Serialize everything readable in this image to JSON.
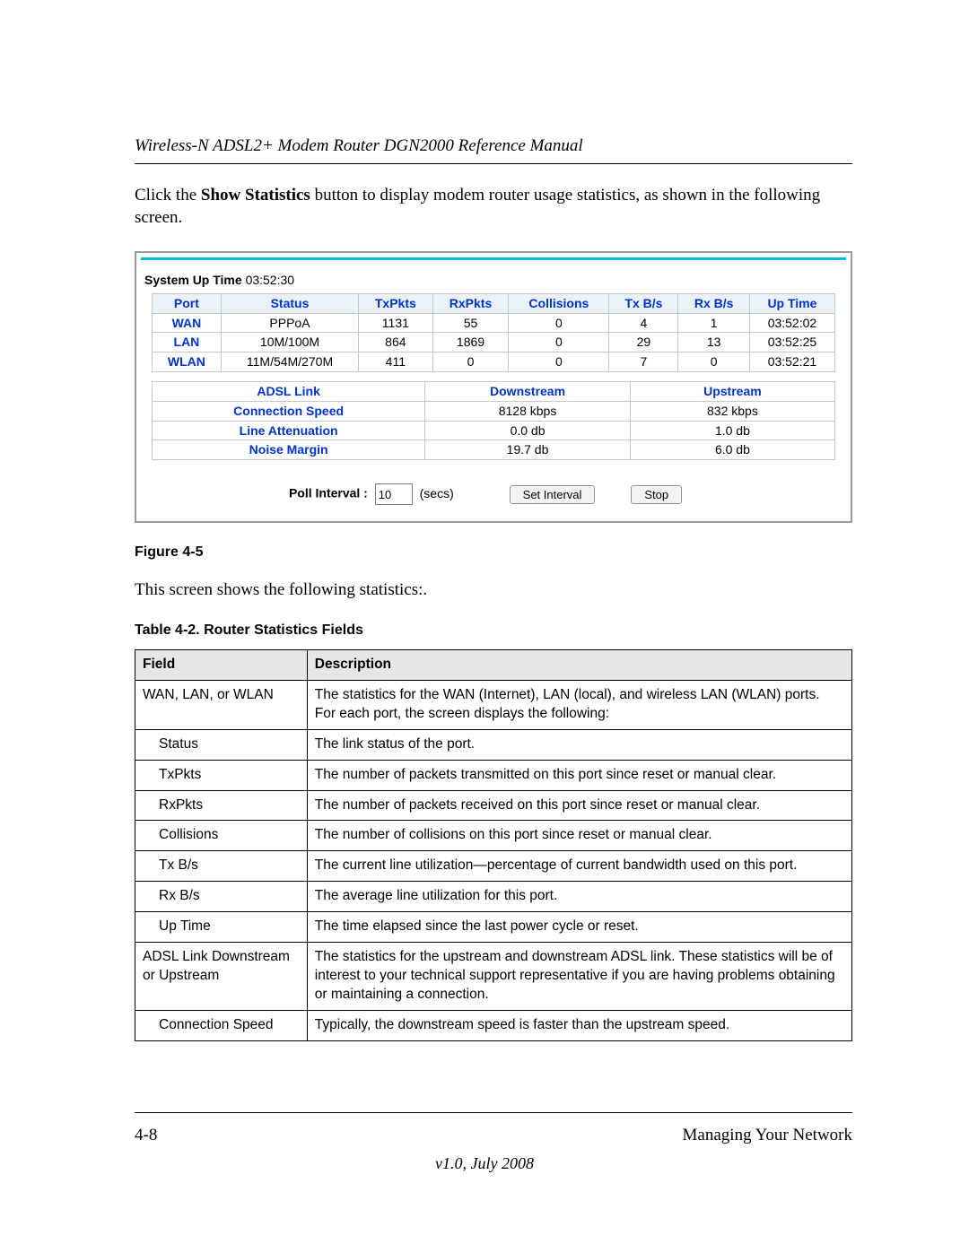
{
  "header": {
    "running_title": "Wireless-N ADSL2+ Modem Router DGN2000 Reference Manual"
  },
  "intro": {
    "pre": "Click the ",
    "bold": "Show Statistics",
    "post": " button to display modem router usage statistics, as shown in the following screen."
  },
  "screenshot": {
    "system_up_time_label": "System Up Time",
    "system_up_time_value": "03:52:30",
    "stats": {
      "headers": [
        "Port",
        "Status",
        "TxPkts",
        "RxPkts",
        "Collisions",
        "Tx B/s",
        "Rx B/s",
        "Up Time"
      ],
      "rows": [
        {
          "port": "WAN",
          "status": "PPPoA",
          "tx": "1131",
          "rx": "55",
          "col": "0",
          "txbs": "4",
          "rxbs": "1",
          "up": "03:52:02"
        },
        {
          "port": "LAN",
          "status": "10M/100M",
          "tx": "864",
          "rx": "1869",
          "col": "0",
          "txbs": "29",
          "rxbs": "13",
          "up": "03:52:25"
        },
        {
          "port": "WLAN",
          "status": "11M/54M/270M",
          "tx": "411",
          "rx": "0",
          "col": "0",
          "txbs": "7",
          "rxbs": "0",
          "up": "03:52:21"
        }
      ]
    },
    "adsl": {
      "headers": [
        "ADSL Link",
        "Downstream",
        "Upstream"
      ],
      "rows": [
        {
          "label": "Connection Speed",
          "down": "8128 kbps",
          "up": "832 kbps"
        },
        {
          "label": "Line Attenuation",
          "down": "0.0 db",
          "up": "1.0 db"
        },
        {
          "label": "Noise Margin",
          "down": "19.7 db",
          "up": "6.0 db"
        }
      ]
    },
    "poll": {
      "label": "Poll Interval :",
      "value": "10",
      "unit": "(secs)",
      "set_button": "Set Interval",
      "stop_button": "Stop"
    }
  },
  "figure_caption": "Figure 4-5",
  "mid_paragraph": "This screen shows the following statistics:.",
  "table_title": "Table 4-2.  Router Statistics Fields",
  "fields_table": {
    "headers": [
      "Field",
      "Description"
    ],
    "rows": [
      {
        "indent": false,
        "field": "WAN, LAN, or WLAN",
        "desc": "The statistics for the WAN (Internet), LAN (local), and wireless LAN (WLAN) ports. For each port, the screen displays the following:"
      },
      {
        "indent": true,
        "field": "Status",
        "desc": "The link status of the port."
      },
      {
        "indent": true,
        "field": "TxPkts",
        "desc": "The number of packets transmitted on this port since reset or manual clear."
      },
      {
        "indent": true,
        "field": "RxPkts",
        "desc": "The number of packets received on this port since reset or manual clear."
      },
      {
        "indent": true,
        "field": "Collisions",
        "desc": "The number of collisions on this port since reset or manual clear."
      },
      {
        "indent": true,
        "field": "Tx B/s",
        "desc": "The current line utilization—percentage of current bandwidth used on this port."
      },
      {
        "indent": true,
        "field": "Rx B/s",
        "desc": "The average line utilization for this port."
      },
      {
        "indent": true,
        "field": "Up Time",
        "desc": "The time elapsed since the last power cycle or reset."
      },
      {
        "indent": false,
        "field": "ADSL Link Downstream or Upstream",
        "desc": "The statistics for the upstream and downstream ADSL link. These statistics will be of interest to your technical support representative if you are having problems obtaining or maintaining a connection."
      },
      {
        "indent": true,
        "field": "Connection Speed",
        "desc": "Typically, the downstream speed is faster than the upstream speed."
      }
    ]
  },
  "footer": {
    "page_number": "4-8",
    "section": "Managing Your Network",
    "version": "v1.0, July 2008"
  }
}
